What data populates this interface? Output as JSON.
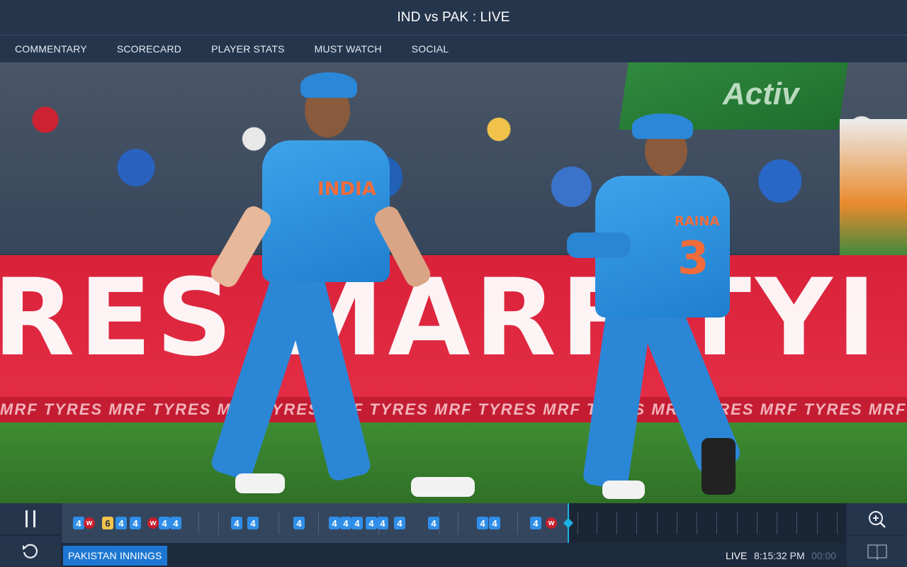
{
  "header": {
    "title": "IND vs PAK : LIVE"
  },
  "nav": {
    "tabs": [
      "COMMENTARY",
      "SCORECARD",
      "PLAYER STATS",
      "MUST WATCH",
      "SOCIAL"
    ]
  },
  "video": {
    "board_text": "RES MARF TYI",
    "strip_text": "MRF TYRES  MRF TYRES  MRF TYRES  MRF TYRES  MRF TYRES  MRF TYRES  MRF TYRES  MRF TYRES  MRF TYRES",
    "jersey_front": "INDIA",
    "jersey_back_name": "RAINA",
    "jersey_back_number": "3"
  },
  "controls": {
    "pause_icon": "pause-icon",
    "replay_icon": "replay-icon",
    "zoom_icon": "zoom-in-icon",
    "guide_icon": "book-icon"
  },
  "timeline": {
    "balls": [
      {
        "label": "4",
        "type": "four"
      },
      {
        "label": "W",
        "type": "wicket"
      },
      {
        "label": "6",
        "type": "six"
      },
      {
        "label": "4",
        "type": "four"
      },
      {
        "label": "4",
        "type": "four"
      },
      {
        "label": "W",
        "type": "wicket"
      },
      {
        "label": "4",
        "type": "four"
      },
      {
        "label": "4",
        "type": "four"
      },
      {
        "label": "4",
        "type": "four"
      },
      {
        "label": "4",
        "type": "four"
      },
      {
        "label": "4",
        "type": "four"
      },
      {
        "label": "4",
        "type": "four"
      },
      {
        "label": "4",
        "type": "four"
      },
      {
        "label": "4",
        "type": "four"
      },
      {
        "label": "4",
        "type": "four"
      },
      {
        "label": "4",
        "type": "four"
      },
      {
        "label": "4",
        "type": "four"
      },
      {
        "label": "4",
        "type": "four"
      },
      {
        "label": "4",
        "type": "four"
      },
      {
        "label": "4",
        "type": "four"
      },
      {
        "label": "4",
        "type": "four"
      },
      {
        "label": "W",
        "type": "wicket"
      }
    ],
    "colors": {
      "four": "#2f8ee8",
      "six": "#f2c24b",
      "wicket": "#c81f2d",
      "playhead": "#1db2e5"
    }
  },
  "status": {
    "innings": "PAKISTAN INNINGS",
    "live": "LIVE",
    "time": "8:15:32 PM",
    "elapsed": "00:00"
  }
}
